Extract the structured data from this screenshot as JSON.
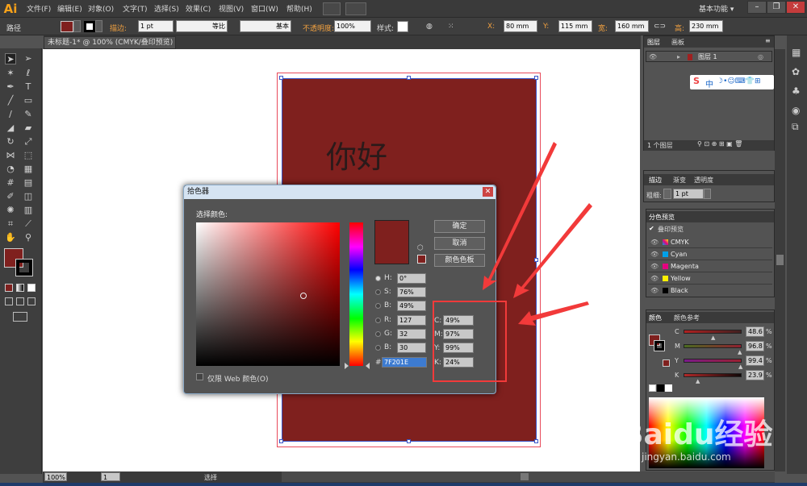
{
  "app": {
    "logo": "Ai",
    "workspace": "基本功能 ▾"
  },
  "menu": [
    "文件(F)",
    "编辑(E)",
    "对象(O)",
    "文字(T)",
    "选择(S)",
    "效果(C)",
    "视图(V)",
    "窗口(W)",
    "帮助(H)"
  ],
  "control": {
    "mode": "路径",
    "stroke_label": "描边:",
    "stroke_weight": "1 pt",
    "profile": "等比",
    "brush": "基本",
    "opacity_label": "不透明度:",
    "opacity": "100%",
    "style_label": "样式:",
    "x_label": "X:",
    "x": "80 mm",
    "y_label": "Y:",
    "y": "115 mm",
    "w_label": "宽:",
    "w": "160 mm",
    "h_label": "高:",
    "h": "230 mm"
  },
  "document": {
    "tab": "未标题-1* @ 100% (CMYK/叠印预览)",
    "text": "你好"
  },
  "picker": {
    "title": "拾色器",
    "select_label": "选择颜色:",
    "ok": "确定",
    "cancel": "取消",
    "swatches": "颜色色板",
    "fields": [
      {
        "label": "H:",
        "value": "0°"
      },
      {
        "label": "S:",
        "value": "76%"
      },
      {
        "label": "B:",
        "value": "49%"
      },
      {
        "label": "R:",
        "value": "127"
      },
      {
        "label": "G:",
        "value": "32"
      },
      {
        "label": "B:",
        "value": "30"
      }
    ],
    "cmyk": [
      {
        "label": "C:",
        "value": "49%"
      },
      {
        "label": "M:",
        "value": "97%"
      },
      {
        "label": "Y:",
        "value": "99%"
      },
      {
        "label": "K:",
        "value": "24%"
      }
    ],
    "hex_label": "#",
    "hex": "7F201E",
    "web_only": "仅限 Web 颜色(O)",
    "current_color": "#7f201e"
  },
  "layers": {
    "tabs": [
      "图层",
      "画板"
    ],
    "layer_name": "图层 1",
    "count": "1 个图层"
  },
  "stroke_panel": {
    "tabs": [
      "描边",
      "渐变",
      "透明度"
    ],
    "weight_label": "粗细:",
    "weight": "1 pt"
  },
  "separations": {
    "title": "分色预览",
    "overprint": "叠印预览",
    "plates": [
      {
        "name": "CMYK",
        "color": "#888888"
      },
      {
        "name": "Cyan",
        "color": "#00a0e9"
      },
      {
        "name": "Magenta",
        "color": "#e4007f"
      },
      {
        "name": "Yellow",
        "color": "#fff100"
      },
      {
        "name": "Black",
        "color": "#000000"
      }
    ]
  },
  "color_panel": {
    "tabs": [
      "颜色",
      "颜色参考"
    ],
    "channels": [
      {
        "label": "C",
        "value": "48.6",
        "pct": 0.486
      },
      {
        "label": "M",
        "value": "96.8",
        "pct": 0.968
      },
      {
        "label": "Y",
        "value": "99.4",
        "pct": 0.994
      },
      {
        "label": "K",
        "value": "23.9",
        "pct": 0.239
      }
    ],
    "unit": "%"
  },
  "status": {
    "zoom": "100%",
    "page": "1",
    "tool": "选择"
  },
  "ime": {
    "label": "中"
  },
  "watermark": {
    "text": "Baidu经验",
    "url": "jingyan.baidu.com"
  }
}
